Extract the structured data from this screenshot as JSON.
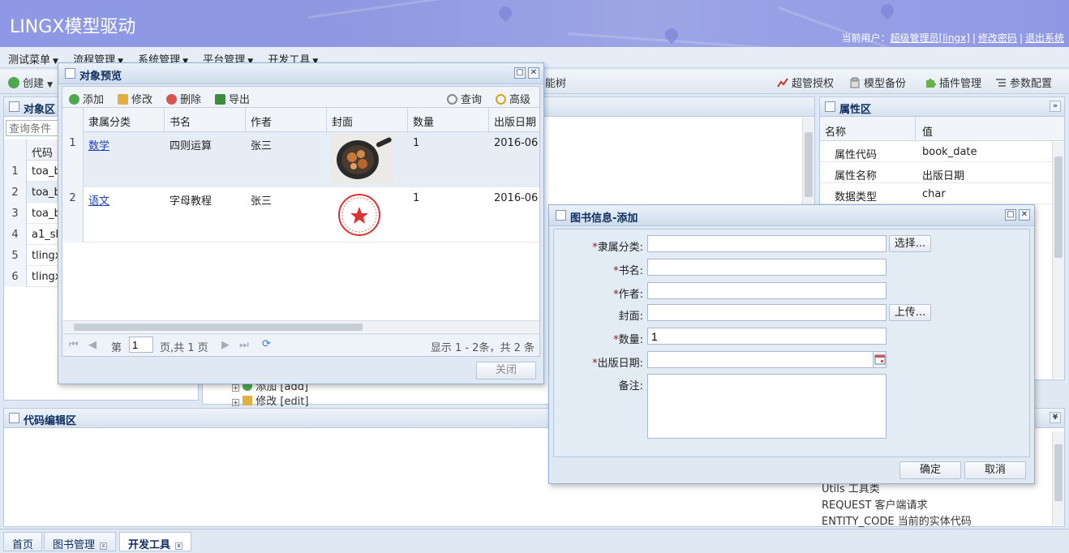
{
  "header": {
    "title": "LINGX模型驱动",
    "user_prefix": "当前用户：",
    "user_name": "超级管理员[lingx]",
    "change_password": "修改密码",
    "logout": "退出系统"
  },
  "menu": [
    "测试菜单",
    "流程管理",
    "系统管理",
    "平台管理",
    "开发工具"
  ],
  "toolbar": {
    "create": "创建",
    "tree_suffix": "能树",
    "super_auth": "超管授权",
    "model_backup": "模型备份",
    "plugin_mgmt": "插件管理",
    "param_config": "参数配置"
  },
  "object_panel": {
    "title": "对象区",
    "query_placeholder": "查询条件",
    "column": "代码",
    "rows": [
      {
        "num": "1",
        "code": "toa_b"
      },
      {
        "num": "2",
        "code": "toa_b"
      },
      {
        "num": "3",
        "code": "toa_b"
      },
      {
        "num": "4",
        "code": "a1_sh"
      },
      {
        "num": "5",
        "code": "tlingx"
      },
      {
        "num": "6",
        "code": "tlingx"
      }
    ]
  },
  "tree_bits": {
    "add": "添加 [add]",
    "edit": "修改 [edit]"
  },
  "property_panel": {
    "title": "属性区",
    "col_name": "名称",
    "col_value": "值",
    "rows": [
      {
        "name": "属性代码",
        "value": "book_date"
      },
      {
        "name": "属性名称",
        "value": "出版日期"
      },
      {
        "name": "数据类型",
        "value": "char"
      }
    ]
  },
  "code_panel": {
    "title": "代码编辑区",
    "help_lines": [
      "Utils 工具类",
      "REQUEST 客户端请求",
      "ENTITY_CODE 当前的实体代码"
    ]
  },
  "preview_dialog": {
    "title": "对象预览",
    "toolbar": {
      "add": "添加",
      "edit": "修改",
      "delete": "删除",
      "export": "导出",
      "query": "查询",
      "advanced": "高级"
    },
    "columns": [
      "隶属分类",
      "书名",
      "作者",
      "封面",
      "数量",
      "出版日期"
    ],
    "rows": [
      {
        "num": "1",
        "category": "数学",
        "name": "四则运算",
        "author": "张三",
        "cover": "pan-image",
        "qty": "1",
        "date": "2016-06"
      },
      {
        "num": "2",
        "category": "语文",
        "name": "字母教程",
        "author": "张三",
        "cover": "stamp-image",
        "qty": "1",
        "date": "2016-06"
      }
    ],
    "pager": {
      "page_prefix": "第",
      "page": "1",
      "page_suffix": "页,共 1 页",
      "summary": "显示 1 - 2条，共 2 条"
    },
    "close": "关闭"
  },
  "form_dialog": {
    "title": "图书信息-添加",
    "fields": [
      {
        "label": "隶属分类:",
        "required": true,
        "value": "",
        "button": "选择..."
      },
      {
        "label": "书名:",
        "required": true,
        "value": ""
      },
      {
        "label": "作者:",
        "required": true,
        "value": ""
      },
      {
        "label": "封面:",
        "required": false,
        "value": "",
        "button": "上传..."
      },
      {
        "label": "数量:",
        "required": true,
        "value": "1"
      },
      {
        "label": "出版日期:",
        "required": true,
        "value": ""
      }
    ],
    "remark_label": "备注:",
    "ok": "确定",
    "cancel": "取消"
  },
  "tabs": [
    "首页",
    "图书管理",
    "开发工具"
  ],
  "colors": {
    "header_bg": "#8e98e6",
    "panel_title": "#0e2d5f",
    "required_mark": "#cc0000",
    "link": "#1a3fbf"
  }
}
